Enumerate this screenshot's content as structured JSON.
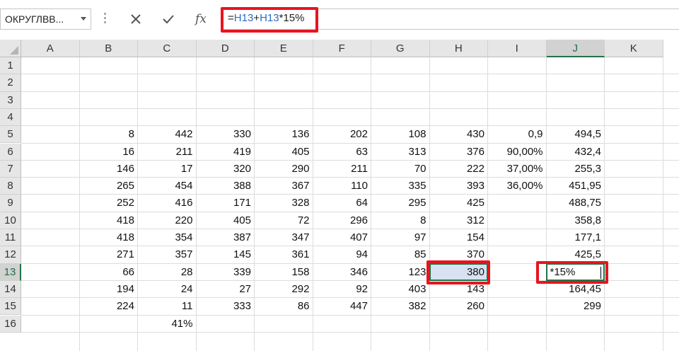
{
  "name_box": {
    "value": "ОКРУГЛВВ..."
  },
  "formula_bar": {
    "cancel_icon": "cancel-x-icon",
    "enter_icon": "checkmark-icon",
    "fx_label": "fx",
    "formula_tokens": [
      {
        "text": "=",
        "type": "plain"
      },
      {
        "text": "H13",
        "type": "ref"
      },
      {
        "text": "+",
        "type": "plain"
      },
      {
        "text": "H13",
        "type": "ref"
      },
      {
        "text": "*15%",
        "type": "plain"
      }
    ]
  },
  "colors": {
    "reference_blue": "#2b6cc4",
    "highlight_red": "#e8141f",
    "selection_green": "#217346",
    "selected_fill": "#d9e2f3"
  },
  "columns": [
    "A",
    "B",
    "C",
    "D",
    "E",
    "F",
    "G",
    "H",
    "I",
    "J",
    "K"
  ],
  "rows": [
    "1",
    "2",
    "3",
    "4",
    "5",
    "6",
    "7",
    "8",
    "9",
    "10",
    "11",
    "12",
    "13",
    "14",
    "15",
    "16"
  ],
  "active_column": "J",
  "active_row": "13",
  "cells": {
    "5": {
      "B": "8",
      "C": "442",
      "D": "330",
      "E": "136",
      "F": "202",
      "G": "108",
      "H": "430",
      "I": "0,9",
      "J": "494,5"
    },
    "6": {
      "B": "16",
      "C": "211",
      "D": "419",
      "E": "405",
      "F": "63",
      "G": "313",
      "H": "376",
      "I": "90,00%",
      "J": "432,4"
    },
    "7": {
      "B": "146",
      "C": "17",
      "D": "320",
      "E": "290",
      "F": "211",
      "G": "70",
      "H": "222",
      "I": "37,00%",
      "J": "255,3"
    },
    "8": {
      "B": "265",
      "C": "454",
      "D": "388",
      "E": "367",
      "F": "110",
      "G": "335",
      "H": "393",
      "I": "36,00%",
      "J": "451,95"
    },
    "9": {
      "B": "252",
      "C": "416",
      "D": "171",
      "E": "328",
      "F": "64",
      "G": "295",
      "H": "425",
      "J": "488,75"
    },
    "10": {
      "B": "418",
      "C": "220",
      "D": "405",
      "E": "72",
      "F": "296",
      "G": "8",
      "H": "312",
      "J": "358,8"
    },
    "11": {
      "B": "418",
      "C": "354",
      "D": "387",
      "E": "347",
      "F": "407",
      "G": "97",
      "H": "154",
      "J": "177,1"
    },
    "12": {
      "B": "271",
      "C": "357",
      "D": "145",
      "E": "361",
      "F": "94",
      "G": "85",
      "H": "370",
      "J": "425,5"
    },
    "13": {
      "B": "66",
      "C": "28",
      "D": "339",
      "E": "158",
      "F": "346",
      "G": "123",
      "H": "380"
    },
    "14": {
      "B": "194",
      "C": "24",
      "D": "27",
      "E": "292",
      "F": "92",
      "G": "403",
      "H": "143",
      "J": "164,45"
    },
    "15": {
      "B": "224",
      "C": "11",
      "D": "333",
      "E": "86",
      "F": "447",
      "G": "382",
      "H": "260",
      "J": "299"
    },
    "16": {
      "C": "41%"
    }
  },
  "selected_reference_cell": {
    "col": "H",
    "row": "13"
  },
  "edit_cell": {
    "col": "J",
    "row": "13",
    "text": "*15%"
  }
}
